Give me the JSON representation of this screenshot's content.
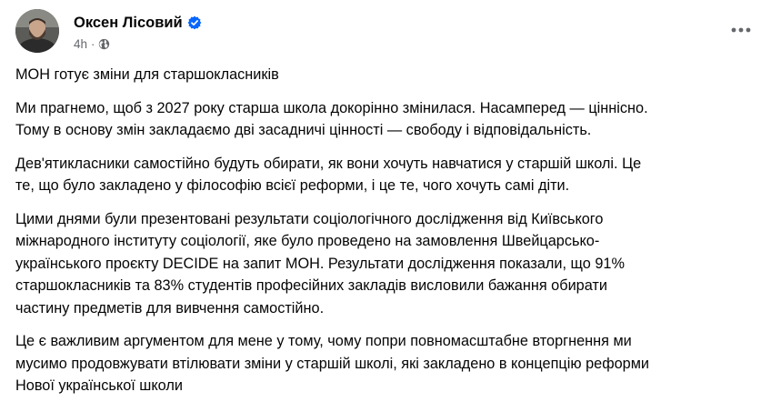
{
  "post": {
    "author": "Оксен Лісовий",
    "time": "4h",
    "separator": "·",
    "verified_icon": "verified-badge-icon",
    "privacy_icon": "globe-icon",
    "more_icon": "more-options-icon",
    "colors": {
      "accent": "#0866ff",
      "secondary_text": "#65676b",
      "primary_text": "#050505"
    },
    "paragraphs": [
      "МОН готує зміни для старшокласників",
      "Ми прагнемо, щоб з 2027 року старша школа докорінно змінилася. Насамперед — ціннісно.\nТому в основу змін закладаємо дві засадничі цінності — свободу і відповідальність.",
      "Дев'ятикласники самостійно будуть обирати, як вони хочуть навчатися у старшій школі. Це\nте, що було закладено у філософію всієї реформи, і це те, чого хочуть самі діти.",
      "Цими днями були презентовані результати соціологічного дослідження від Київського\nміжнародного інституту соціології, яке було проведено на замовлення Швейцарсько-\nукраїнського проєкту DECIDE на запит МОН. Результати дослідження показали, що 91%\nстаршокласників та 83% студентів професійних закладів висловили бажання обирати\nчастину предметів для вивчення самостійно.",
      "Це є важливим аргументом для мене у тому, чому попри повномасштабне вторгнення ми\nмусимо продовжувати втілювати зміни у старшій школі, які закладено в концепцію реформи\nНової української школи"
    ]
  }
}
